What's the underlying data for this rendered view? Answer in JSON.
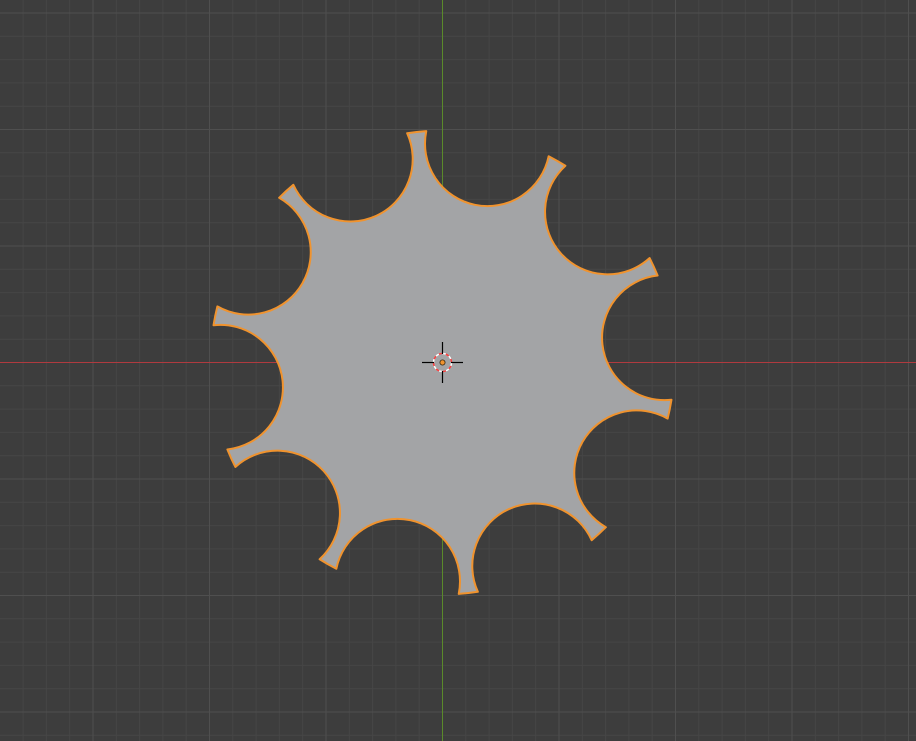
{
  "viewport": {
    "view": "top-orthographic",
    "colors": {
      "background": "#3d3d3d",
      "grid_minor": "#464646",
      "grid_major": "#4f4f4f",
      "x_axis": "#b03a3f",
      "y_axis": "#5a8a2a",
      "mesh_fill": "#a3a4a6",
      "selection_outline": "#f0932e",
      "cursor_ring_a": "#ffffff",
      "cursor_ring_b": "#ff4040",
      "cursor_crosshair": "#000000",
      "origin_dot": "#f0932e"
    }
  },
  "object": {
    "shape": "gear",
    "teeth": 10,
    "selected": true
  },
  "cursor_3d": {
    "icon": "3d-cursor-icon"
  },
  "origin": {
    "icon": "object-origin-icon"
  }
}
